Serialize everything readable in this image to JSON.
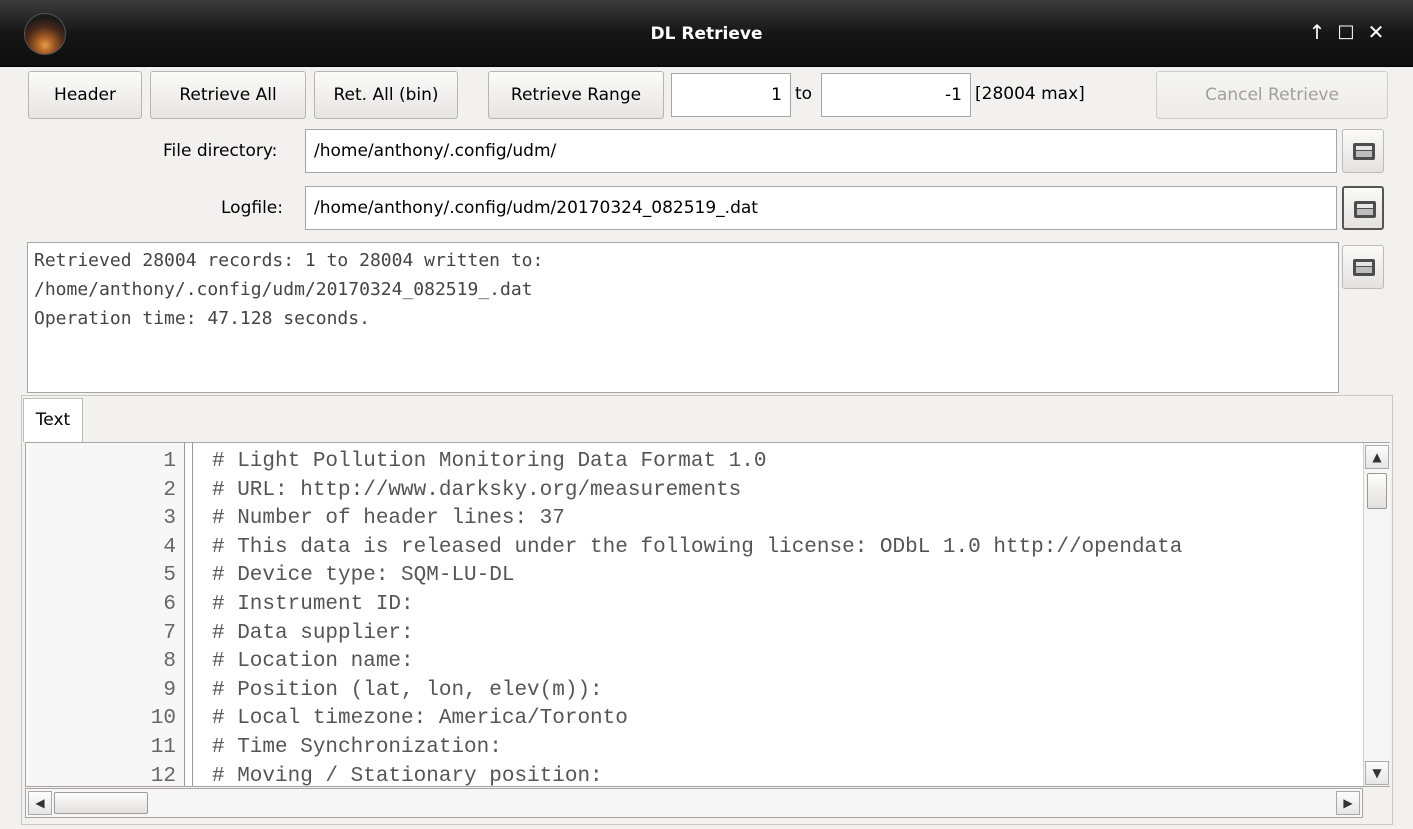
{
  "window": {
    "title": "DL Retrieve",
    "controls": {
      "keep_above": "↑",
      "maximize": "□",
      "close": "✕"
    }
  },
  "toolbar": {
    "header_label": "Header",
    "retrieve_all_label": "Retrieve All",
    "ret_all_bin_label": "Ret. All (bin)",
    "retrieve_range_label": "Retrieve Range",
    "range_from": "1",
    "range_to_label": "to",
    "range_to": "-1",
    "max_label": "[28004 max]",
    "cancel_label": "Cancel Retrieve"
  },
  "file_directory": {
    "label": "File directory:",
    "value": "/home/anthony/.config/udm/"
  },
  "logfile": {
    "label": "Logfile:",
    "value": "/home/anthony/.config/udm/20170324_082519_.dat"
  },
  "status_log": [
    "Retrieved 28004 records: 1 to 28004 written to:",
    "/home/anthony/.config/udm/20170324_082519_.dat",
    "Operation time: 47.128 seconds."
  ],
  "tabs": [
    {
      "label": "Text"
    }
  ],
  "editor": {
    "lines": [
      {
        "num": "1",
        "text": "# Light Pollution Monitoring Data Format 1.0"
      },
      {
        "num": "2",
        "text": "# URL: http://www.darksky.org/measurements"
      },
      {
        "num": "3",
        "text": "# Number of header lines: 37"
      },
      {
        "num": "4",
        "text": "# This data is released under the following license: ODbL 1.0 http://opendata"
      },
      {
        "num": "5",
        "text": "# Device type: SQM-LU-DL"
      },
      {
        "num": "6",
        "text": "# Instrument ID:"
      },
      {
        "num": "7",
        "text": "# Data supplier:"
      },
      {
        "num": "8",
        "text": "# Location name:"
      },
      {
        "num": "9",
        "text": "# Position (lat, lon, elev(m)):"
      },
      {
        "num": "10",
        "text": "# Local timezone: America/Toronto"
      },
      {
        "num": "11",
        "text": "# Time Synchronization:"
      },
      {
        "num": "12",
        "text": "# Moving / Stationary position:"
      }
    ]
  },
  "colors": {
    "titlebar": "#161616",
    "field_border": "#a7a5a2",
    "window_bg": "#f2f1f0"
  },
  "icons": {
    "app": "dl-retrieve-app-icon",
    "folder": "folder-open-icon"
  }
}
